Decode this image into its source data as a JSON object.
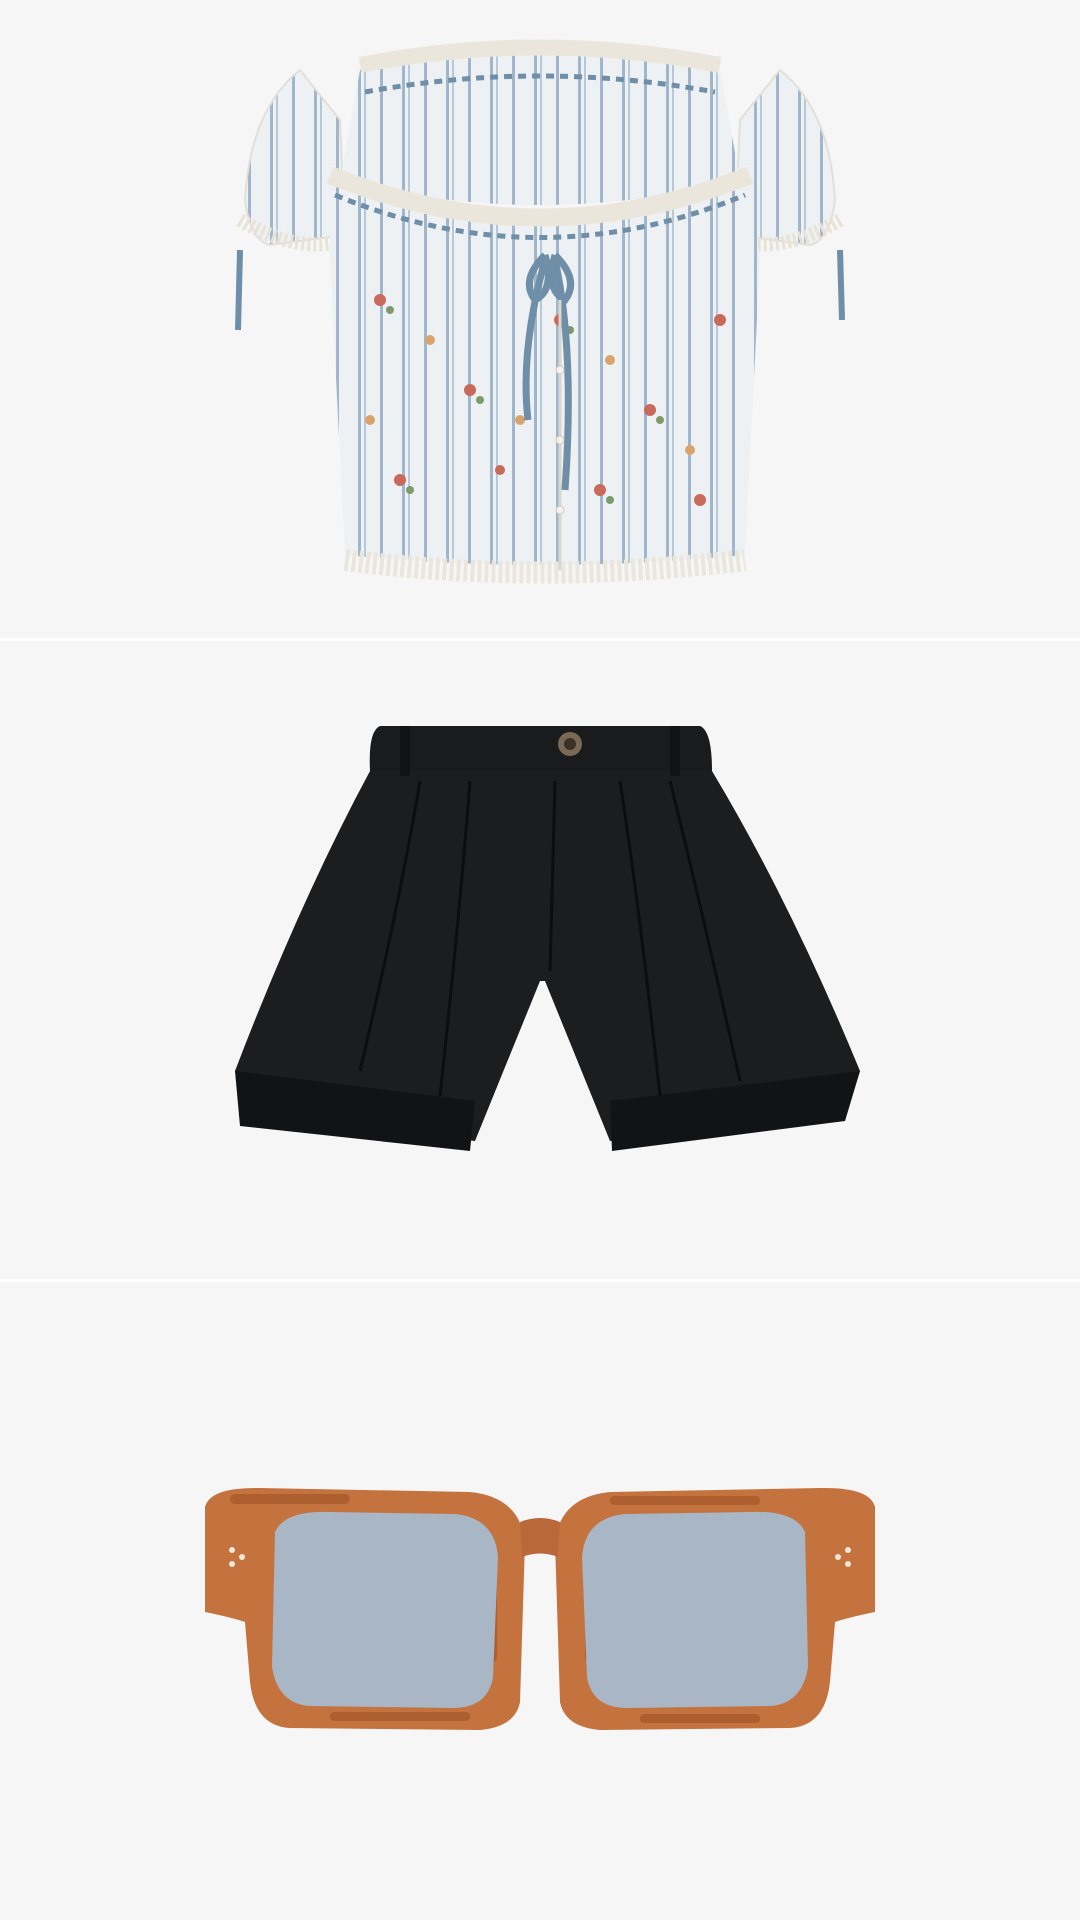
{
  "collage": {
    "items": [
      {
        "name": "floral-puff-sleeve-crop-top",
        "colors": {
          "base": "#eef1f2",
          "stripe": "#9fb6cc",
          "ribbon": "#6f8ea8",
          "lace": "#ebe6dc"
        }
      },
      {
        "name": "black-pleated-cuffed-shorts",
        "colors": {
          "base": "#1a1b1d",
          "shade": "#0f1012",
          "button": "#7a6a55"
        }
      },
      {
        "name": "tortoiseshell-sunglasses",
        "colors": {
          "frame": "#c4733f",
          "frame_dark": "#9a4f24",
          "lens": "#a9b6c6"
        }
      }
    ],
    "background": "#f6f6f7",
    "divider_color": "#ffffff"
  }
}
